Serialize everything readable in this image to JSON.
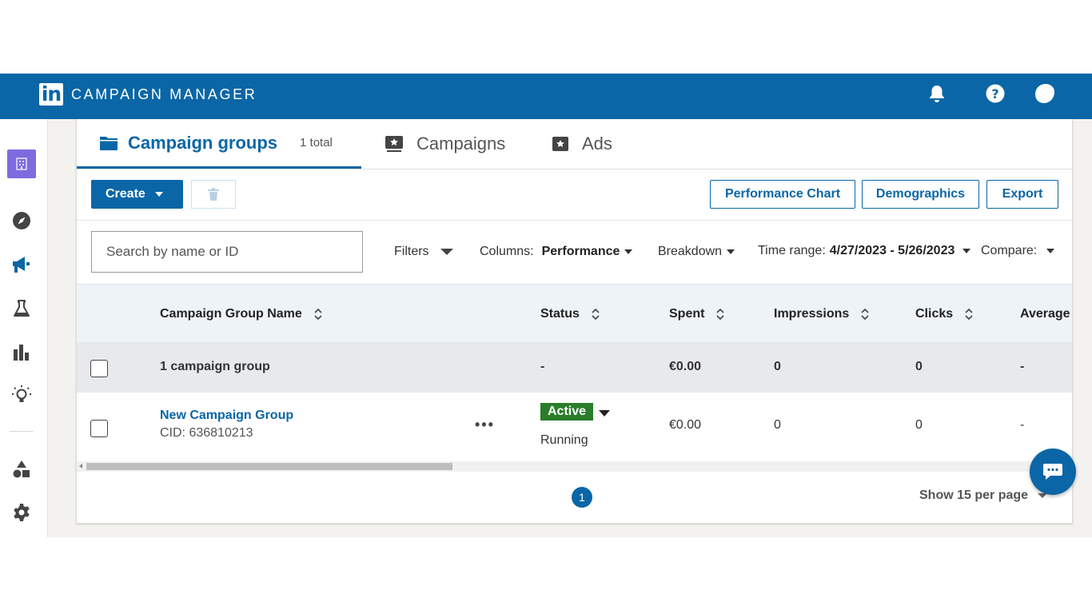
{
  "header": {
    "logo_text": "in",
    "app_title": "CAMPAIGN MANAGER",
    "icons": [
      "bell-icon",
      "help-icon",
      "avatar"
    ]
  },
  "sidebar": {
    "icons": [
      "account-icon",
      "compass-icon",
      "megaphone-icon",
      "lab-flask-icon",
      "bar-chart-icon",
      "lightbulb-icon",
      "shapes-icon",
      "gear-icon"
    ]
  },
  "tabs": [
    {
      "label": "Campaign groups",
      "count": "1 total",
      "icon": "folder-icon"
    },
    {
      "label": "Campaigns",
      "icon": "campaign-star-icon"
    },
    {
      "label": "Ads",
      "icon": "ad-star-icon"
    }
  ],
  "toolbar": {
    "create_label": "Create",
    "performance_chart_label": "Performance Chart",
    "demographics_label": "Demographics",
    "export_label": "Export"
  },
  "filters": {
    "search_placeholder": "Search by name or ID",
    "filters_label": "Filters",
    "columns_label": "Columns:",
    "columns_value": "Performance",
    "breakdown_label": "Breakdown",
    "time_range_label": "Time range:",
    "time_range_value": "4/27/2023 - 5/26/2023",
    "compare_label": "Compare:"
  },
  "table": {
    "columns": [
      "Campaign Group Name",
      "Status",
      "Spent",
      "Impressions",
      "Clicks",
      "Average"
    ],
    "summary": {
      "name": "1 campaign group",
      "status": "-",
      "spent": "€0.00",
      "impressions": "0",
      "clicks": "0",
      "average": "-"
    },
    "rows": [
      {
        "name": "New Campaign Group",
        "cid": "CID: 636810213",
        "status_badge": "Active",
        "status_text": "Running",
        "spent": "€0.00",
        "impressions": "0",
        "clicks": "0",
        "average": "-"
      }
    ]
  },
  "pagination": {
    "current_page": "1",
    "per_page_label": "Show 15 per page"
  },
  "colors": {
    "brand": "#0a66a6",
    "active_badge": "#2a7d2a",
    "sidebar_selected": "#7e6be0"
  }
}
